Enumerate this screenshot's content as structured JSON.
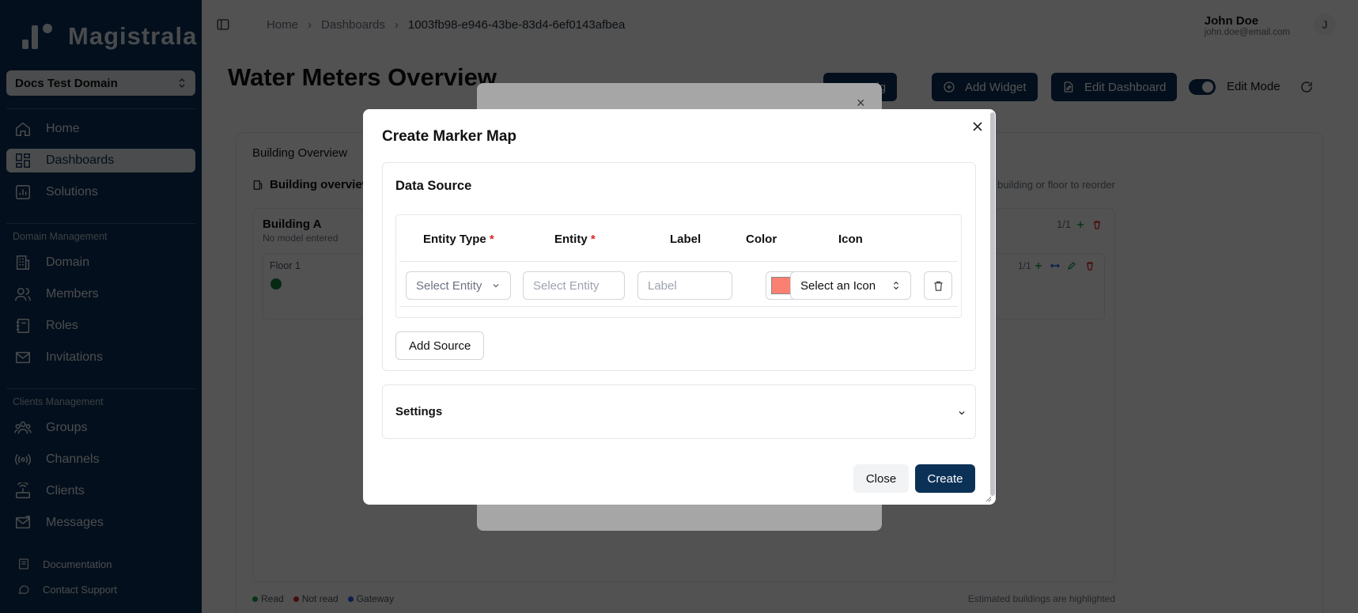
{
  "app": {
    "logo_text": "Magistrala",
    "domain_select": "Docs Test Domain"
  },
  "sidebar": {
    "top_items": [
      {
        "label": "Home",
        "icon": "home-icon"
      },
      {
        "label": "Dashboards",
        "icon": "dashboard-icon",
        "active": true
      },
      {
        "label": "Solutions",
        "icon": "solutions-icon"
      }
    ],
    "domain_section": "Domain Management",
    "domain_items": [
      {
        "label": "Domain",
        "icon": "building-icon"
      },
      {
        "label": "Members",
        "icon": "users-icon"
      },
      {
        "label": "Roles",
        "icon": "notebook-icon"
      },
      {
        "label": "Invitations",
        "icon": "mail-icon"
      }
    ],
    "clients_section": "Clients Management",
    "clients_items": [
      {
        "label": "Groups",
        "icon": "groups-icon"
      },
      {
        "label": "Channels",
        "icon": "radio-icon"
      },
      {
        "label": "Clients",
        "icon": "router-icon"
      },
      {
        "label": "Messages",
        "icon": "messages-icon"
      }
    ],
    "footer_items": [
      {
        "label": "Documentation",
        "icon": "book-icon"
      },
      {
        "label": "Contact Support",
        "icon": "chat-icon"
      }
    ]
  },
  "header": {
    "breadcrumb": [
      "Home",
      "Dashboards",
      "1003fb98-e946-43be-83d4-6ef0143afbea"
    ],
    "user_name": "John Doe",
    "user_email": "john.doe@email.com",
    "avatar_initial": "J"
  },
  "page": {
    "title": "Water Meters Overview",
    "layout_button": "Layout: lg",
    "add_widget": "Add Widget",
    "edit_dashboard": "Edit Dashboard",
    "edit_mode_label": "Edit Mode",
    "edit_mode_on": true
  },
  "widget": {
    "title": "Building Overview",
    "subtitle": "Building overview",
    "reorder_hint": "building or floor to reorder",
    "building_name": "Building A",
    "building_sub": "No model entered",
    "building_count": "1/1",
    "floor_name": "Floor 1",
    "floor_count": "1/1",
    "legend": [
      {
        "label": "Read",
        "color": "#16a34a"
      },
      {
        "label": "Not read",
        "color": "#dc2626"
      },
      {
        "label": "Gateway",
        "color": "#2563eb"
      }
    ],
    "estimated_note": "Estimated buildings are highlighted"
  },
  "modal": {
    "title": "Create Marker Map",
    "data_source_title": "Data Source",
    "columns": {
      "entity_type": "Entity Type",
      "entity": "Entity",
      "label": "Label",
      "color": "Color",
      "icon": "Icon",
      "required_mark": "*"
    },
    "row": {
      "entity_type_value": "Select Entity",
      "entity_placeholder": "Select Entity",
      "label_placeholder": "Label",
      "color_value": "#fa8072",
      "icon_value": "Select an Icon"
    },
    "add_source": "Add Source",
    "settings_title": "Settings",
    "close_button": "Close",
    "create_button": "Create"
  }
}
